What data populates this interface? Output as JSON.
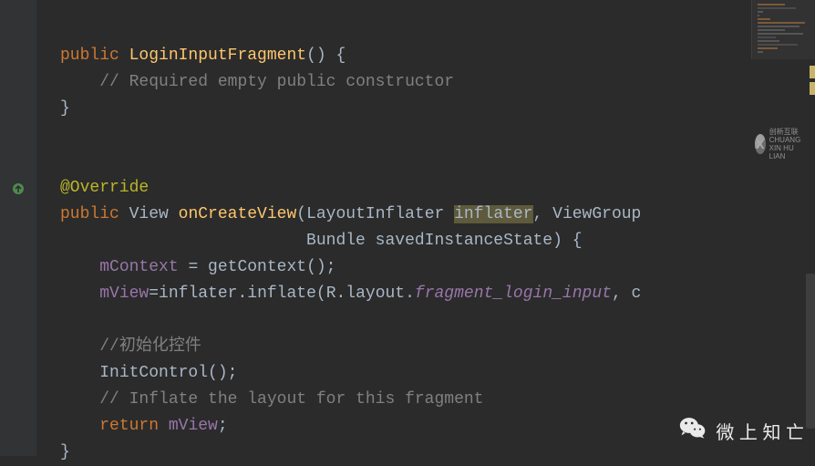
{
  "code": {
    "line1": {
      "kw": "public ",
      "name": "LoginInputFragment",
      "paren_open": "() {",
      "pad": ""
    },
    "line2": {
      "indent": "    ",
      "comment": "// Required empty public constructor"
    },
    "line3": {
      "brace": "}"
    },
    "line4": {
      "blank": ""
    },
    "line5": {
      "blank": ""
    },
    "line6": {
      "anno": "@Override"
    },
    "line7": {
      "kw": "public ",
      "type": "View ",
      "name": "onCreateView",
      "open": "(",
      "ptype1": "LayoutInflater ",
      "pname1": "inflater",
      "comma1": ", ",
      "ptype2": "ViewGroup"
    },
    "line8": {
      "indent": "                         ",
      "ptype3": "Bundle ",
      "pname3": "savedInstanceState",
      "close": ") {"
    },
    "line9": {
      "indent": "    ",
      "field": "mContext",
      "assign": " = getContext();"
    },
    "line10": {
      "indent": "    ",
      "field": "mView",
      "eq": "=",
      "pcall": "inflater.inflate(",
      "r": "R.layout.",
      "res": "fragment_login_input",
      "comma": ", c"
    },
    "line11": {
      "blank": ""
    },
    "line12": {
      "indent": "    ",
      "comment": "//初始化控件"
    },
    "line13": {
      "indent": "    ",
      "call": "InitControl();"
    },
    "line14": {
      "indent": "    ",
      "comment": "// Inflate the layout for this fragment"
    },
    "line15": {
      "indent": "    ",
      "kw": "return ",
      "field": "mView",
      "semi": ";"
    },
    "line16": {
      "brace": "}"
    }
  },
  "overlay": {
    "wechat_text": "微 上 知 亡",
    "watermark_line1": "创新互联",
    "watermark_line2": "CHUANG XIN HU LIAN"
  }
}
